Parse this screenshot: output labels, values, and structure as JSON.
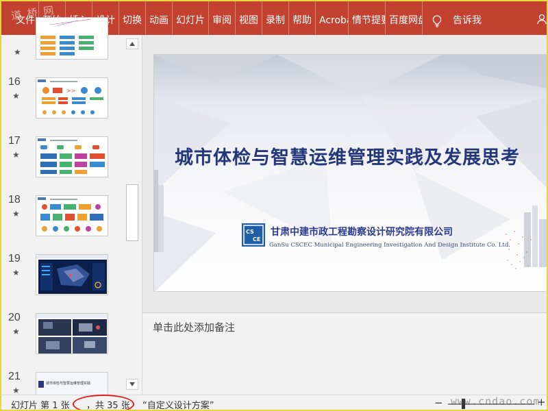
{
  "watermark_logo": "道 桥 网",
  "ribbon": {
    "tabs": [
      "文件",
      "开始",
      "插入",
      "设计",
      "切换",
      "动画",
      "幻灯片",
      "审阅",
      "视图",
      "录制",
      "帮助",
      "Acrobat",
      "情节提要",
      "百度网盘"
    ],
    "tell_me": "告诉我"
  },
  "slides": [
    {
      "number": "16",
      "star": "★"
    },
    {
      "number": "17",
      "star": "★"
    },
    {
      "number": "18",
      "star": "★"
    },
    {
      "number": "19",
      "star": "★"
    },
    {
      "number": "20",
      "star": "★"
    },
    {
      "number": "21",
      "star": "★"
    }
  ],
  "top_partial_star": "★",
  "thumb_21_text": "城市体检与智慧运维管理实践",
  "main_slide": {
    "title": "城市体检与智慧运维管理实践及发展思考",
    "org_cn": "甘肃中建市政工程勘察设计研究院有限公司",
    "org_en": "GanSu CSCEC Municipal Engineering Investigation And Design Institute Co. Ltd."
  },
  "notes_placeholder": "单击此处添加备注",
  "status": {
    "slide_info": "幻灯片 第 1 张",
    "total": "，共 35 张",
    "theme": "“自定义设计方案”",
    "zoom_minus": "−",
    "zoom_plus": "+",
    "site_watermark": "www.cndao.com"
  },
  "colors": {
    "ribbon_bg": "#c2422f",
    "title_color": "#24377a",
    "highlight_ellipse": "#e01c1c"
  }
}
